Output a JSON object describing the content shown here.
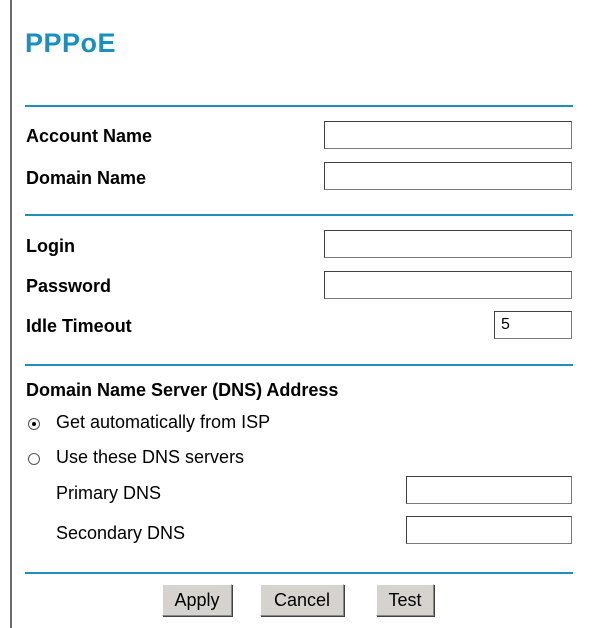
{
  "title": "PPPoE",
  "account_section": {
    "account_name_label": "Account Name",
    "account_name_value": "",
    "domain_name_label": "Domain Name",
    "domain_name_value": ""
  },
  "login_section": {
    "login_label": "Login",
    "login_value": "",
    "password_label": "Password",
    "password_value": "",
    "idle_timeout_label": "Idle Timeout",
    "idle_timeout_value": "5"
  },
  "dns_section": {
    "heading": "Domain Name Server (DNS) Address",
    "option_auto_label": "Get automatically from ISP",
    "option_manual_label": "Use these DNS servers",
    "selected": "auto",
    "primary_label": "Primary DNS",
    "primary_value": "",
    "secondary_label": "Secondary DNS",
    "secondary_value": ""
  },
  "buttons": {
    "apply": "Apply",
    "cancel": "Cancel",
    "test": "Test"
  }
}
